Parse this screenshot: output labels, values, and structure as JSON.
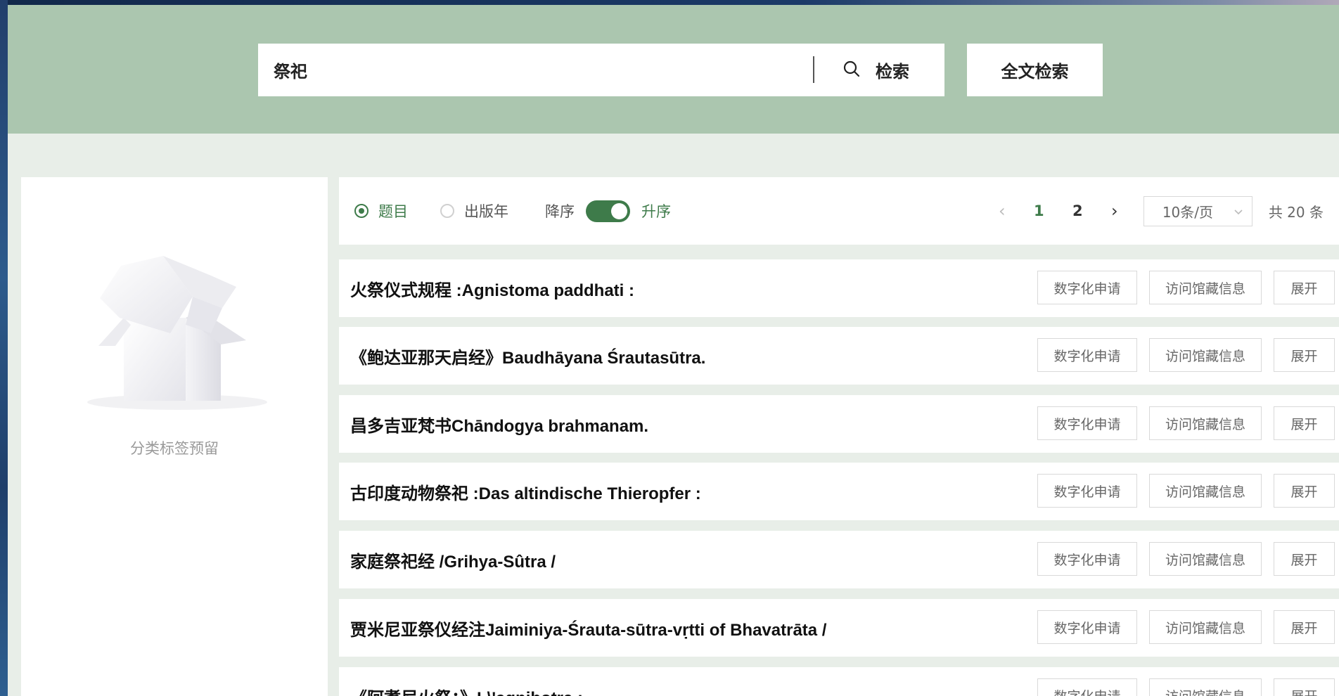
{
  "search": {
    "query": "祭祀",
    "button_label": "检索",
    "fulltext_label": "全文检索"
  },
  "sidebar": {
    "empty_text": "分类标签预留"
  },
  "toolbar": {
    "sort_title_label": "题目",
    "sort_year_label": "出版年",
    "desc_label": "降序",
    "asc_label": "升序",
    "selected_sort": "题目",
    "ascending": true
  },
  "pagination": {
    "prev_arrow": "‹",
    "next_arrow": "›",
    "pages": [
      "1",
      "2"
    ],
    "current_page": "1",
    "page_size": "10条/页",
    "total": "共 20 条"
  },
  "result_actions": {
    "digitize": "数字化申请",
    "holdings": "访问馆藏信息",
    "expand": "展开"
  },
  "results": [
    {
      "title": "火祭仪式规程 :Agnistoma paddhati :"
    },
    {
      "title": "《鲍达亚那天启经》Baudhāyana Śrautasūtra."
    },
    {
      "title": "昌多吉亚梵书Chāndogya brahmanam."
    },
    {
      "title": "古印度动物祭祀 :Das altindische Thieropfer :"
    },
    {
      "title": "家庭祭祀经 /Grihya-Sûtra /"
    },
    {
      "title": "贾米尼亚祭仪经注Jaiminiya-Śrauta-sūtra-vṛtti of Bhavatrāta /"
    },
    {
      "title": "《阿耆尼火祭：》L\\'agnihotra :"
    }
  ],
  "colors": {
    "header_bg": "#abc6af",
    "page_bg": "#e8eee8",
    "accent": "#3e7b4a"
  }
}
